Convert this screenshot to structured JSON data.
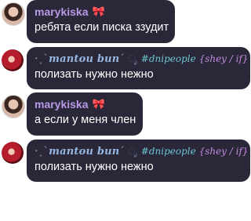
{
  "messages": [
    {
      "author": "marykiska",
      "author_badge": "🎀",
      "text": "ребята если писка ззудит"
    },
    {
      "author": "mantou bun",
      "author_prefix": "·˛`",
      "author_suffix": "´",
      "author_icons": "ೃ",
      "status": "#dnipeople",
      "status_tags": "{shey / if}",
      "text": "полизать нужно нежно"
    },
    {
      "author": "marykiska",
      "author_badge": "🎀",
      "text": "а если у меня член"
    },
    {
      "author": "mantou bun",
      "author_prefix": "·˛`",
      "author_suffix": "´",
      "author_icons": "ೃ",
      "status": "#dnipeople",
      "status_tags": "{shey / if}",
      "text": "полизать нужно нежно"
    }
  ]
}
